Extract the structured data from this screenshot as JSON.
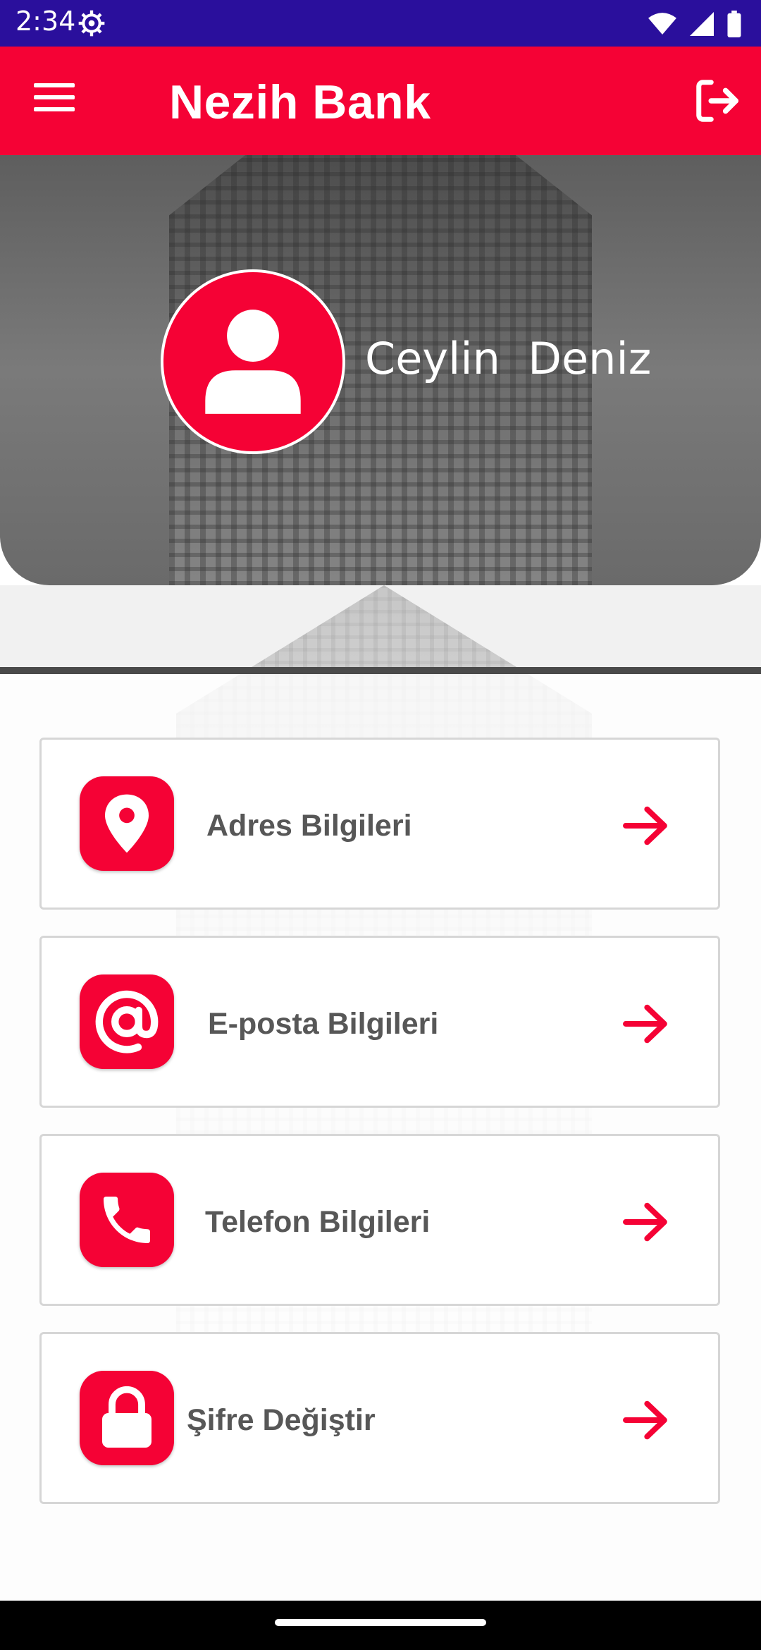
{
  "status_bar": {
    "time": "2:34",
    "icons": [
      "settings-gear-icon",
      "wifi-icon",
      "cellular-signal-icon",
      "battery-icon"
    ]
  },
  "app_bar": {
    "title": "Nezih Bank",
    "menu_icon": "hamburger-menu-icon",
    "logout_icon": "logout-icon"
  },
  "profile": {
    "name": "Ceylin  Deniz",
    "avatar_icon": "user-icon"
  },
  "menu_items": [
    {
      "label": "Adres Bilgileri",
      "icon": "location-pin-icon"
    },
    {
      "label": "E-posta Bilgileri",
      "icon": "at-sign-icon"
    },
    {
      "label": "Telefon Bilgileri",
      "icon": "phone-icon"
    },
    {
      "label": "Şifre Değiştir",
      "icon": "lock-icon"
    }
  ],
  "colors": {
    "brand_red": "#f50235",
    "status_bar": "#2a0f9c",
    "label_gray": "#575757"
  }
}
